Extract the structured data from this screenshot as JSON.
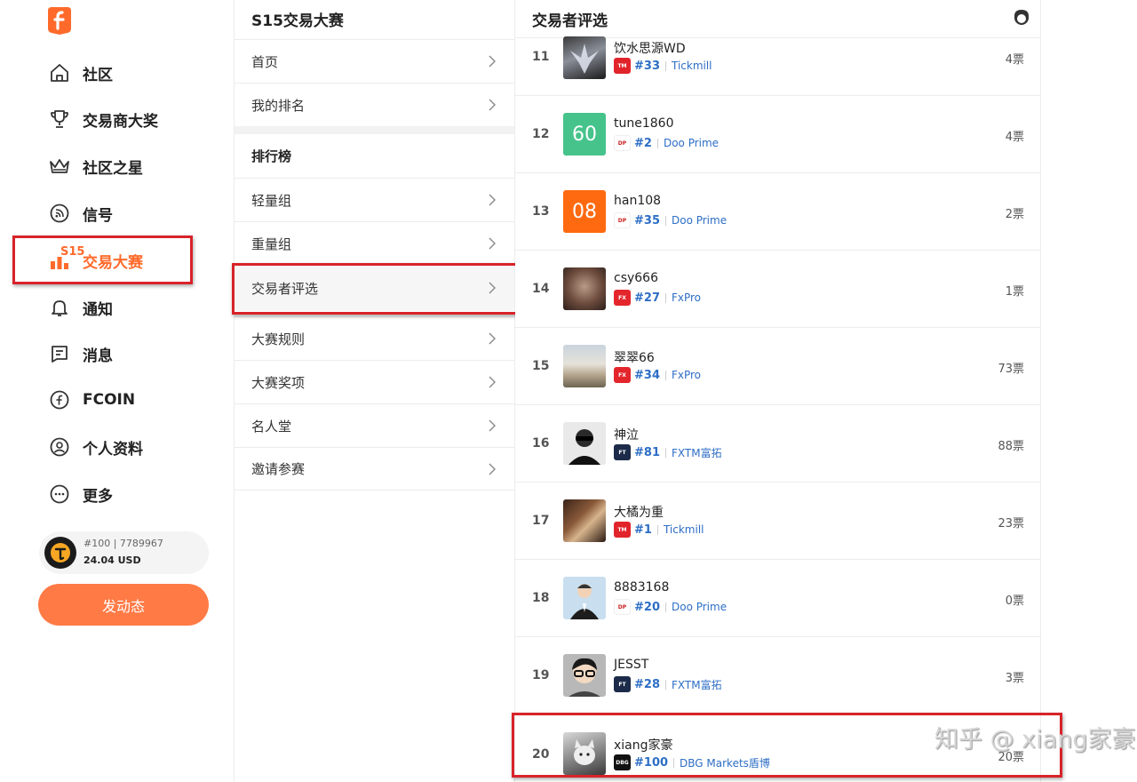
{
  "sidebar": {
    "items": [
      {
        "label": "社区",
        "icon": "home-icon"
      },
      {
        "label": "交易商大奖",
        "icon": "trophy-icon"
      },
      {
        "label": "社区之星",
        "icon": "crown-icon"
      },
      {
        "label": "信号",
        "icon": "signal-icon"
      },
      {
        "label": "交易大赛",
        "icon": "contest-chart-icon",
        "badge": "S15",
        "active": true
      },
      {
        "label": "通知",
        "icon": "bell-icon"
      },
      {
        "label": "消息",
        "icon": "message-icon"
      },
      {
        "label": "FCOIN",
        "icon": "fcoin-icon"
      },
      {
        "label": "个人资料",
        "icon": "profile-icon"
      },
      {
        "label": "更多",
        "icon": "more-icon"
      }
    ],
    "user": {
      "meta": "#100 | 7789967",
      "balance": "24.04 USD"
    },
    "post_button": "发动态"
  },
  "contest_menu": {
    "title": "S15交易大赛",
    "items_top": [
      "首页",
      "我的排名"
    ],
    "section": "排行榜",
    "items_bottom": [
      "轻量组",
      "重量组",
      "交易者评选",
      "大赛规则",
      "大赛奖项",
      "名人堂",
      "邀请参赛"
    ],
    "selected": "交易者评选"
  },
  "traders_panel": {
    "title": "交易者评选",
    "rows": [
      {
        "rank": "11",
        "name": "饮水思源WD",
        "num": "#33",
        "broker": "Tickmill",
        "votes": "4票",
        "pic_text": ""
      },
      {
        "rank": "12",
        "name": "tune1860",
        "num": "#2",
        "broker": "Doo Prime",
        "votes": "4票",
        "pic_text": "60"
      },
      {
        "rank": "13",
        "name": "han108",
        "num": "#35",
        "broker": "Doo Prime",
        "votes": "2票",
        "pic_text": "08"
      },
      {
        "rank": "14",
        "name": "csy666",
        "num": "#27",
        "broker": "FxPro",
        "votes": "1票",
        "pic_text": ""
      },
      {
        "rank": "15",
        "name": "翠翠66",
        "num": "#34",
        "broker": "FxPro",
        "votes": "73票",
        "pic_text": ""
      },
      {
        "rank": "16",
        "name": "神泣",
        "num": "#81",
        "broker": "FXTM富拓",
        "votes": "88票",
        "pic_text": ""
      },
      {
        "rank": "17",
        "name": "大橘为重",
        "num": "#1",
        "broker": "Tickmill",
        "votes": "23票",
        "pic_text": ""
      },
      {
        "rank": "18",
        "name": "8883168",
        "num": "#20",
        "broker": "Doo Prime",
        "votes": "0票",
        "pic_text": ""
      },
      {
        "rank": "19",
        "name": "JESST",
        "num": "#28",
        "broker": "FXTM富拓",
        "votes": "3票",
        "pic_text": ""
      },
      {
        "rank": "20",
        "name": "xiang家豪",
        "num": "#100",
        "broker": "DBG Markets盾博",
        "votes": "20票",
        "pic_text": ""
      }
    ]
  },
  "watermark": "知乎 @ xiang家豪",
  "colors": {
    "accent": "#ff6a2b",
    "highlight_box": "#d8232a",
    "link": "#2d6ec5"
  }
}
